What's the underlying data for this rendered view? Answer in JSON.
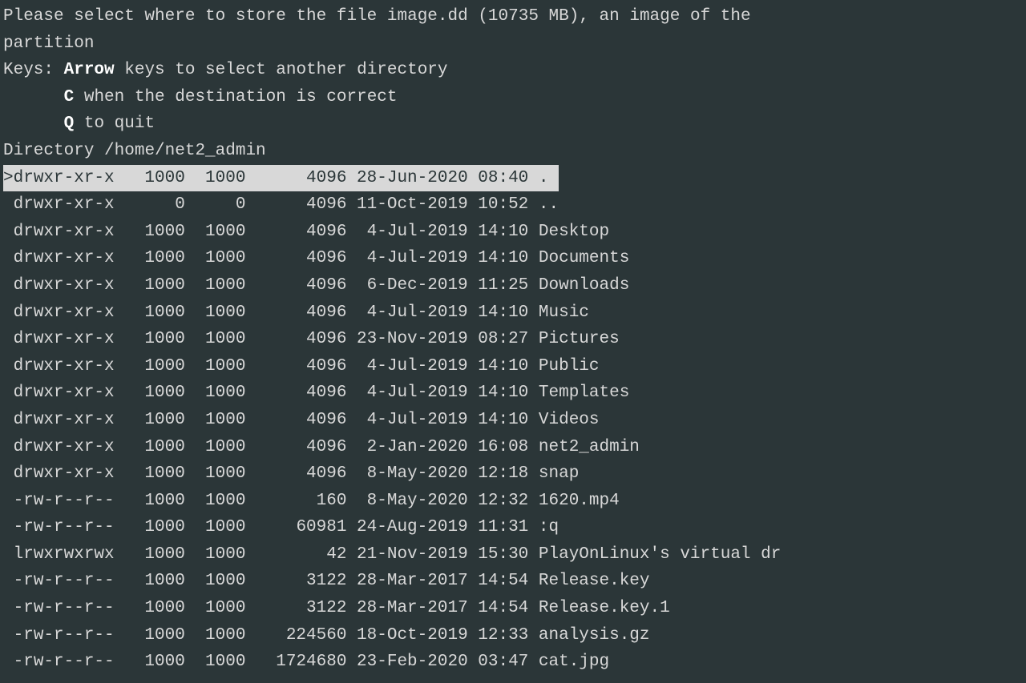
{
  "prompt": {
    "line1a": "Please select where to store the file ",
    "filename": "image.dd",
    "line1b": " (10735 MB), an image of the",
    "line2": "partition",
    "keys_label": "Keys: ",
    "key_arrow_bold": "Arrow",
    "key_arrow_text": " keys to select another directory",
    "key_c_pad": "      ",
    "key_c_bold": "C",
    "key_c_text": " when the destination is correct",
    "key_q_pad": "      ",
    "key_q_bold": "Q",
    "key_q_text": " to quit"
  },
  "directory": {
    "label": "Directory ",
    "path": "/home/net2_admin"
  },
  "files": [
    {
      "selected": true,
      "cursor": ">",
      "perms": "drwxr-xr-x",
      "uid": "1000",
      "gid": "1000",
      "size": "4096",
      "date": "28-Jun-2020",
      "time": "08:40",
      "name": "."
    },
    {
      "selected": false,
      "cursor": " ",
      "perms": "drwxr-xr-x",
      "uid": "0",
      "gid": "0",
      "size": "4096",
      "date": "11-Oct-2019",
      "time": "10:52",
      "name": ".."
    },
    {
      "selected": false,
      "cursor": " ",
      "perms": "drwxr-xr-x",
      "uid": "1000",
      "gid": "1000",
      "size": "4096",
      "date": "4-Jul-2019",
      "time": "14:10",
      "name": "Desktop"
    },
    {
      "selected": false,
      "cursor": " ",
      "perms": "drwxr-xr-x",
      "uid": "1000",
      "gid": "1000",
      "size": "4096",
      "date": "4-Jul-2019",
      "time": "14:10",
      "name": "Documents"
    },
    {
      "selected": false,
      "cursor": " ",
      "perms": "drwxr-xr-x",
      "uid": "1000",
      "gid": "1000",
      "size": "4096",
      "date": "6-Dec-2019",
      "time": "11:25",
      "name": "Downloads"
    },
    {
      "selected": false,
      "cursor": " ",
      "perms": "drwxr-xr-x",
      "uid": "1000",
      "gid": "1000",
      "size": "4096",
      "date": "4-Jul-2019",
      "time": "14:10",
      "name": "Music"
    },
    {
      "selected": false,
      "cursor": " ",
      "perms": "drwxr-xr-x",
      "uid": "1000",
      "gid": "1000",
      "size": "4096",
      "date": "23-Nov-2019",
      "time": "08:27",
      "name": "Pictures"
    },
    {
      "selected": false,
      "cursor": " ",
      "perms": "drwxr-xr-x",
      "uid": "1000",
      "gid": "1000",
      "size": "4096",
      "date": "4-Jul-2019",
      "time": "14:10",
      "name": "Public"
    },
    {
      "selected": false,
      "cursor": " ",
      "perms": "drwxr-xr-x",
      "uid": "1000",
      "gid": "1000",
      "size": "4096",
      "date": "4-Jul-2019",
      "time": "14:10",
      "name": "Templates"
    },
    {
      "selected": false,
      "cursor": " ",
      "perms": "drwxr-xr-x",
      "uid": "1000",
      "gid": "1000",
      "size": "4096",
      "date": "4-Jul-2019",
      "time": "14:10",
      "name": "Videos"
    },
    {
      "selected": false,
      "cursor": " ",
      "perms": "drwxr-xr-x",
      "uid": "1000",
      "gid": "1000",
      "size": "4096",
      "date": "2-Jan-2020",
      "time": "16:08",
      "name": "net2_admin"
    },
    {
      "selected": false,
      "cursor": " ",
      "perms": "drwxr-xr-x",
      "uid": "1000",
      "gid": "1000",
      "size": "4096",
      "date": "8-May-2020",
      "time": "12:18",
      "name": "snap"
    },
    {
      "selected": false,
      "cursor": " ",
      "perms": "-rw-r--r--",
      "uid": "1000",
      "gid": "1000",
      "size": "160",
      "date": "8-May-2020",
      "time": "12:32",
      "name": "1620.mp4"
    },
    {
      "selected": false,
      "cursor": " ",
      "perms": "-rw-r--r--",
      "uid": "1000",
      "gid": "1000",
      "size": "60981",
      "date": "24-Aug-2019",
      "time": "11:31",
      "name": ":q"
    },
    {
      "selected": false,
      "cursor": " ",
      "perms": "lrwxrwxrwx",
      "uid": "1000",
      "gid": "1000",
      "size": "42",
      "date": "21-Nov-2019",
      "time": "15:30",
      "name": "PlayOnLinux's virtual dr"
    },
    {
      "selected": false,
      "cursor": " ",
      "perms": "-rw-r--r--",
      "uid": "1000",
      "gid": "1000",
      "size": "3122",
      "date": "28-Mar-2017",
      "time": "14:54",
      "name": "Release.key"
    },
    {
      "selected": false,
      "cursor": " ",
      "perms": "-rw-r--r--",
      "uid": "1000",
      "gid": "1000",
      "size": "3122",
      "date": "28-Mar-2017",
      "time": "14:54",
      "name": "Release.key.1"
    },
    {
      "selected": false,
      "cursor": " ",
      "perms": "-rw-r--r--",
      "uid": "1000",
      "gid": "1000",
      "size": "224560",
      "date": "18-Oct-2019",
      "time": "12:33",
      "name": "analysis.gz"
    },
    {
      "selected": false,
      "cursor": " ",
      "perms": "-rw-r--r--",
      "uid": "1000",
      "gid": "1000",
      "size": "1724680",
      "date": "23-Feb-2020",
      "time": "03:47",
      "name": "cat.jpg"
    }
  ]
}
